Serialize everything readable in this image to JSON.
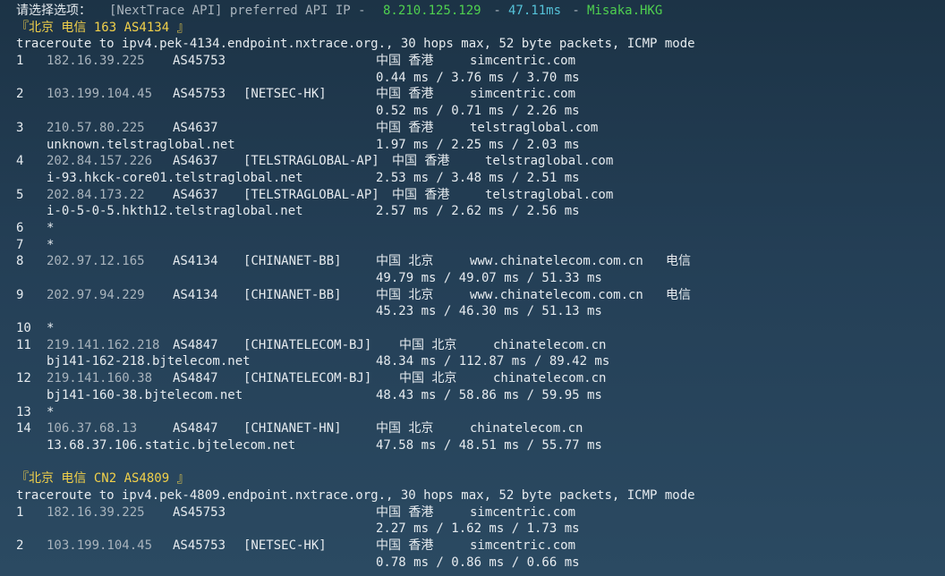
{
  "prompt": {
    "label": "请选择选项：",
    "api_text": "[NextTrace API] preferred API IP - ",
    "ip": "8.210.125.129",
    "sep1": " - ",
    "latency": "47.11ms",
    "sep2": " - ",
    "node": "Misaka.HKG"
  },
  "sections": [
    {
      "title": "『北京 电信 163 AS4134 』",
      "command": "traceroute to ipv4.pek-4134.endpoint.nxtrace.org., 30 hops max, 52 byte packets, ICMP mode",
      "hops": [
        {
          "hop": "1",
          "ip": "182.16.39.225",
          "as": "AS45753",
          "tag": "",
          "loc": "中国 香港",
          "domain": "simcentric.com",
          "isp": "",
          "host": "",
          "rtt": "0.44 ms / 3.76 ms / 3.70 ms"
        },
        {
          "hop": "2",
          "ip": "103.199.104.45",
          "as": "AS45753",
          "tag": "[NETSEC-HK]",
          "loc": "中国 香港",
          "domain": "simcentric.com",
          "isp": "",
          "host": "",
          "rtt": "0.52 ms / 0.71 ms / 2.26 ms"
        },
        {
          "hop": "3",
          "ip": "210.57.80.225",
          "as": "AS4637",
          "tag": "",
          "loc": "中国 香港",
          "domain": "telstraglobal.com",
          "isp": "",
          "host": "unknown.telstraglobal.net",
          "rtt": "1.97 ms / 2.25 ms / 2.03 ms"
        },
        {
          "hop": "4",
          "ip": "202.84.157.226",
          "as": "AS4637",
          "tag": "[TELSTRAGLOBAL-AP]",
          "loc": "中国 香港",
          "domain": "telstraglobal.com",
          "isp": "",
          "host": "i-93.hkck-core01.telstraglobal.net",
          "rtt": "2.53 ms / 3.48 ms / 2.51 ms"
        },
        {
          "hop": "5",
          "ip": "202.84.173.22",
          "as": "AS4637",
          "tag": "[TELSTRAGLOBAL-AP]",
          "loc": "中国 香港",
          "domain": "telstraglobal.com",
          "isp": "",
          "host": "i-0-5-0-5.hkth12.telstraglobal.net",
          "rtt": "2.57 ms / 2.62 ms / 2.56 ms"
        },
        {
          "hop": "6",
          "star": "*"
        },
        {
          "hop": "7",
          "star": "*"
        },
        {
          "hop": "8",
          "ip": "202.97.12.165",
          "as": "AS4134",
          "tag": "[CHINANET-BB]",
          "loc": "中国 北京",
          "domain": "www.chinatelecom.com.cn",
          "isp": "电信",
          "host": "",
          "rtt": "49.79 ms / 49.07 ms / 51.33 ms"
        },
        {
          "hop": "9",
          "ip": "202.97.94.229",
          "as": "AS4134",
          "tag": "[CHINANET-BB]",
          "loc": "中国 北京",
          "domain": "www.chinatelecom.com.cn",
          "isp": "电信",
          "host": "",
          "rtt": "45.23 ms / 46.30 ms / 51.13 ms"
        },
        {
          "hop": "10",
          "star": "*"
        },
        {
          "hop": "11",
          "ip": "219.141.162.218",
          "as": "AS4847",
          "tag": "[CHINATELECOM-BJ]",
          "loc": "中国 北京",
          "domain": "chinatelecom.cn",
          "isp": "",
          "host": "bj141-162-218.bjtelecom.net",
          "rtt": "48.34 ms / 112.87 ms / 89.42 ms"
        },
        {
          "hop": "12",
          "ip": "219.141.160.38",
          "as": "AS4847",
          "tag": "[CHINATELECOM-BJ]",
          "loc": "中国 北京",
          "domain": "chinatelecom.cn",
          "isp": "",
          "host": "bj141-160-38.bjtelecom.net",
          "rtt": "48.43 ms / 58.86 ms / 59.95 ms"
        },
        {
          "hop": "13",
          "star": "*"
        },
        {
          "hop": "14",
          "ip": "106.37.68.13",
          "as": "AS4847",
          "tag": "[CHINANET-HN]",
          "loc": "中国 北京",
          "domain": "chinatelecom.cn",
          "isp": "",
          "host": "13.68.37.106.static.bjtelecom.net",
          "rtt": "47.58 ms / 48.51 ms / 55.77 ms"
        }
      ]
    },
    {
      "title": "『北京 电信 CN2 AS4809 』",
      "command": "traceroute to ipv4.pek-4809.endpoint.nxtrace.org., 30 hops max, 52 byte packets, ICMP mode",
      "hops": [
        {
          "hop": "1",
          "ip": "182.16.39.225",
          "as": "AS45753",
          "tag": "",
          "loc": "中国 香港",
          "domain": "simcentric.com",
          "isp": "",
          "host": "",
          "rtt": "2.27 ms / 1.62 ms / 1.73 ms"
        },
        {
          "hop": "2",
          "ip": "103.199.104.45",
          "as": "AS45753",
          "tag": "[NETSEC-HK]",
          "loc": "中国 香港",
          "domain": "simcentric.com",
          "isp": "",
          "host": "",
          "rtt": "0.78 ms / 0.86 ms / 0.66 ms"
        }
      ]
    }
  ]
}
